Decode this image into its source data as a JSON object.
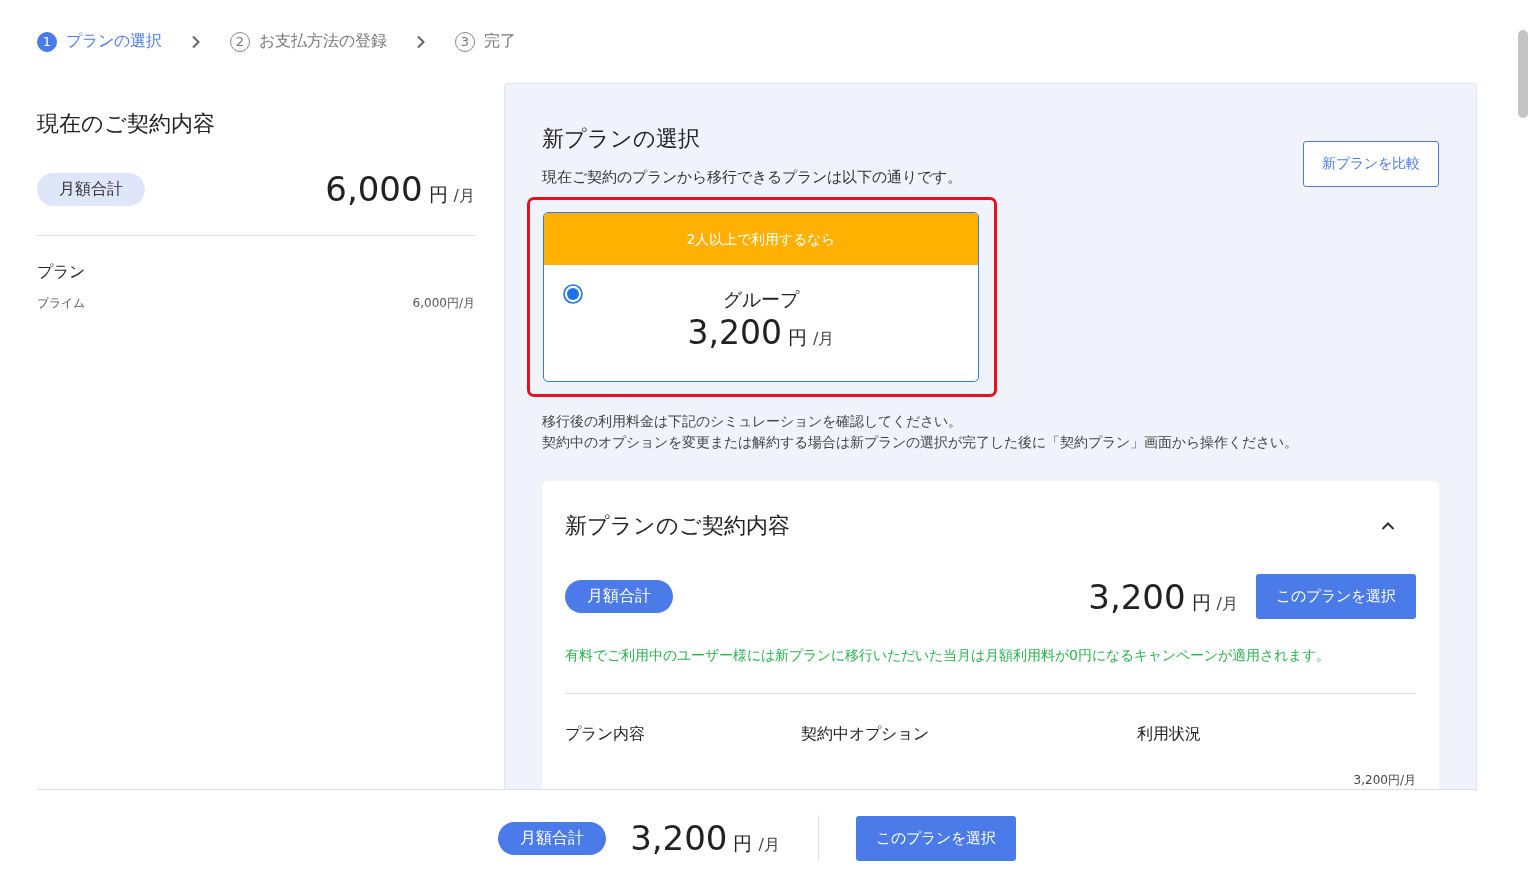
{
  "steps": [
    {
      "number": "1",
      "label": "プランの選択",
      "selected": true
    },
    {
      "number": "2",
      "label": "お支払方法の登録",
      "selected": false
    },
    {
      "number": "3",
      "label": "完了",
      "selected": false
    }
  ],
  "current_contract": {
    "title": "現在のご契約内容",
    "total_label": "月額合計",
    "amount": "6,000",
    "unit": "円",
    "per": "/月",
    "section_title": "プラン",
    "items": [
      {
        "name": "プライム",
        "price": "6,000円/月"
      }
    ]
  },
  "new_plan": {
    "title": "新プランの選択",
    "description": "現在ご契約のプランから移行できるプランは以下の通りです。",
    "compare_button": "新プランを比較",
    "options": [
      {
        "tag": "2人以上で利用するなら",
        "name": "グループ",
        "amount": "3,200",
        "unit": "円",
        "per": "/月",
        "selected": true,
        "highlighted": true
      }
    ],
    "notes": [
      "移行後の利用料金は下記のシミュレーションを確認してください。",
      "契約中のオプションを変更または解約する場合は新プランの選択が完了した後に「契約プラン」画面から操作ください。"
    ]
  },
  "new_contract": {
    "title": "新プランのご契約内容",
    "expanded": true,
    "total_label": "月額合計",
    "amount": "3,200",
    "unit": "円",
    "per": "/月",
    "select_button": "このプランを選択",
    "campaign_note": "有料でご利用中のユーザー様には新プランに移行いただいた当月は月額利用料が0円になるキャンペーンが適用されます。",
    "columns": [
      "プラン内容",
      "契約中オプション",
      "利用状況"
    ],
    "price": "3,200円/月"
  },
  "footer": {
    "total_label": "月額合計",
    "amount": "3,200",
    "unit": "円",
    "per": "/月",
    "select_button": "このプランを選択"
  }
}
